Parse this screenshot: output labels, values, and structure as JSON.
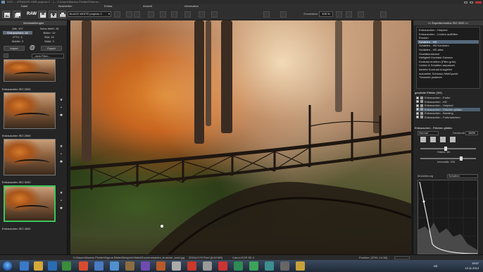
{
  "window": {
    "title": "DXO ... (FRANZIS HDR projects 2 ...) – C:\\Users\\Markus Pichler\\Pictures ...",
    "controls": [
      "minimize",
      "maximize",
      "close"
    ]
  },
  "menu": [
    "Datei",
    "Bearbeiten",
    "Extras",
    "Ansicht",
    "Information"
  ],
  "toolbar": {
    "raw_label": "RAW",
    "preset_selected": "BLACK WHITE projects 2",
    "zoom_label": "Zoomfaktor",
    "zoom_value": "100 %"
  },
  "left_panel": {
    "header": "Voreinstellungen",
    "categories": [
      [
        "Alle: 107",
        "Schw-Weiß: 28"
      ],
      [
        "Entrauschen: 18",
        "Bilder: 10"
      ],
      [
        "IPTC: 4",
        "Bild: 16"
      ],
      [
        "Mobile: 3",
        "Wald: 3"
      ]
    ],
    "import_label": "Import",
    "export_label": "Export",
    "at_symbol": "@",
    "filter_placeholder": "--kein Filter--",
    "presets": [
      "Entrauschen ISO 2000",
      "Entrauschen ISO 2500",
      "Entrauschen ISO 3200",
      "Entrauschen ISO 4000"
    ]
  },
  "right_panel": {
    "header": "<< Expertenmodus ISO 3200 <<",
    "effect_list": [
      "Entrauschen - Hotpixel",
      "Entrauschen - Lücken auffüllen",
      "Erosion",
      "Schärfen - HD",
      "Schärfen - HD Konturen",
      "Schärfen - HD alles",
      "Gradationskurve",
      "Helligkeit Kontrast Gamma",
      "Kontrast erhöhen (Filter grün)",
      "Lichter & Schatten anpassen",
      "leichter Kontrast Ausgleich",
      "manueller Schwarz-/Weißpunkt",
      "Tönwerte justieren"
    ],
    "selected_effect_index": 3,
    "chosen_title": "gewählte Effekte (3/6)",
    "chosen_effects": [
      "Entrauschen - Farbe",
      "Entrauschen - HD",
      "Entrauschen - Hotpixel",
      "Entrauschen - Flächen glätten",
      "Entrauschen - Banding",
      "Entrauschen - Farbrauschen"
    ],
    "chosen_selected_index": 3,
    "flat_section_title": "Entrauschen - Flächen glätten",
    "mode_value": "Normal",
    "opacity_label": "Deckkraft",
    "opacity_value": "100%",
    "strength_label": "Stärke: 80",
    "radius_label": "Intensität: 295",
    "mod_label": "Modulierung",
    "mod_value": "Schatten"
  },
  "statusbar": {
    "path": "D:\\Bauer\\Markus Pichler\\Eigene Bilder\\Beispiele\\Wald\\Sonnenstrahlen_bruecke_wald.jpg",
    "dimensions": "3264x2176 Pixel (8,84 MB)",
    "camera": "Canon EOS 5D II",
    "position": "Position: [3795, 14:38]"
  },
  "taskbar": {
    "time": "19:57",
    "date": "13.11.2013",
    "lang": "DE"
  }
}
